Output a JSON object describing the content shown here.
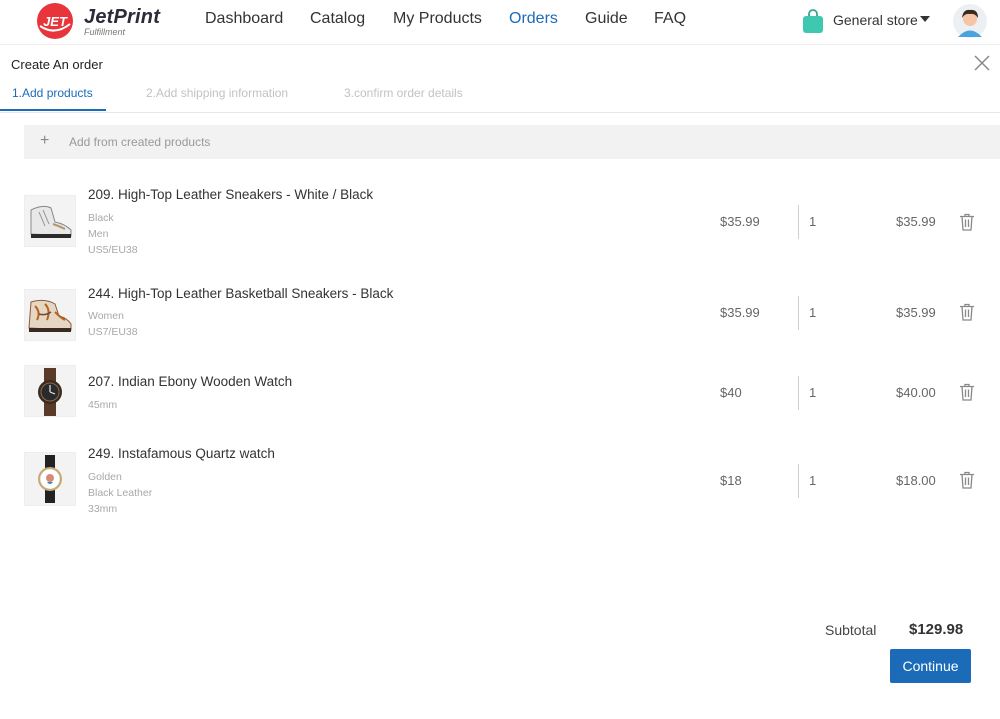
{
  "brand": {
    "name": "JetPrint",
    "subtitle": "Fulfillment",
    "badge_text": "JET"
  },
  "nav": {
    "items": [
      {
        "label": "Dashboard",
        "active": false
      },
      {
        "label": "Catalog",
        "active": false
      },
      {
        "label": "My Products",
        "active": false
      },
      {
        "label": "Orders",
        "active": true
      },
      {
        "label": "Guide",
        "active": false
      },
      {
        "label": "FAQ",
        "active": false
      }
    ],
    "store_label": "General store",
    "active_color": "#1b6bb8"
  },
  "panel": {
    "title": "Create An order",
    "steps": [
      {
        "label": "1.Add products",
        "active": true
      },
      {
        "label": "2.Add shipping information",
        "active": false
      },
      {
        "label": "3.confirm order details",
        "active": false
      }
    ],
    "add_bar_label": "Add from created products"
  },
  "items": [
    {
      "title": "209. High-Top Leather Sneakers - White / Black",
      "meta": [
        "Black",
        "Men",
        "US5/EU38"
      ],
      "price": "$35.99",
      "qty": "1",
      "total": "$35.99",
      "thumb_icon": "sneaker-white-icon"
    },
    {
      "title": "244. High-Top Leather Basketball Sneakers - Black",
      "meta": [
        "Women",
        "US7/EU38"
      ],
      "price": "$35.99",
      "qty": "1",
      "total": "$35.99",
      "thumb_icon": "sneaker-pattern-icon"
    },
    {
      "title": "207. Indian Ebony Wooden Watch",
      "meta": [
        "45mm"
      ],
      "price": "$40",
      "qty": "1",
      "total": "$40.00",
      "thumb_icon": "wooden-watch-icon"
    },
    {
      "title": "249. Instafamous Quartz watch",
      "meta": [
        "Golden",
        "Black Leather",
        "33mm"
      ],
      "price": "$18",
      "qty": "1",
      "total": "$18.00",
      "thumb_icon": "quartz-watch-icon"
    }
  ],
  "summary": {
    "subtotal_label": "Subtotal",
    "subtotal_value": "$129.98",
    "continue_label": "Continue"
  },
  "colors": {
    "accent": "#1b6bb8",
    "brand_red": "#e8343b",
    "store_bag": "#3fc8b0"
  }
}
